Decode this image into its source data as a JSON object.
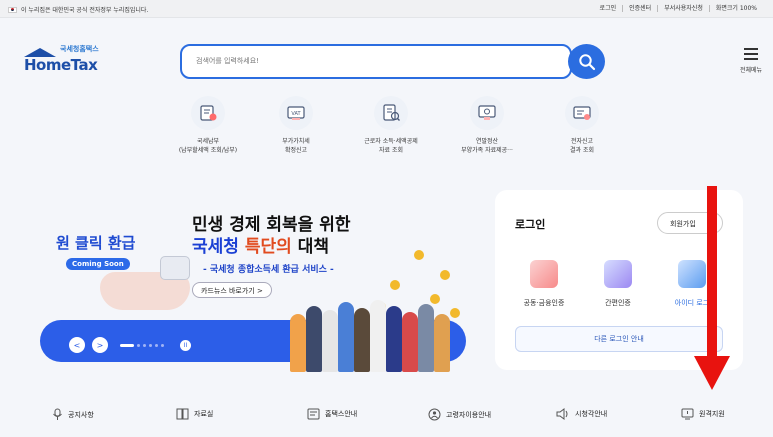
{
  "topbar": {
    "gov_notice": "이 누리집은 대한민국 공식 전자정부 누리집입니다.",
    "links": [
      "로그인",
      "인증센터",
      "부서사용자신청",
      "화면크기 100%"
    ]
  },
  "logo": {
    "small": "국세청홈택스",
    "big": "HomeTax"
  },
  "search": {
    "placeholder": "검색어를 입력하세요!"
  },
  "menu": {
    "label": "전체메뉴"
  },
  "quick_menu": [
    {
      "line1": "국세납부",
      "line2": "(납부할세액 조회/납부)",
      "icon": "tax-payment-icon"
    },
    {
      "line1": "부가가치세",
      "line2": "확정신고",
      "icon": "vat-icon"
    },
    {
      "line1": "근로자 소득·세액공제",
      "line2": "자료 조회",
      "icon": "income-deduction-icon"
    },
    {
      "line1": "연말정산",
      "line2": "부양가족 자료제공···",
      "icon": "year-end-settlement-icon"
    },
    {
      "line1": "전자신고",
      "line2": "결과 조회",
      "icon": "e-filing-result-icon"
    }
  ],
  "banner": {
    "one_click": "원 클릭 환급",
    "coming_soon": "Coming Soon",
    "headline1": "민생 경제 회복을 위한",
    "headline2_a": "국세청",
    "headline2_b": "특단의",
    "headline2_c": "대책",
    "subline": "- 국세청 종합소득세 환급 서비스 -",
    "cardnews": "카드뉴스 바로가기  >",
    "prev": "<",
    "next": ">",
    "pause": "II"
  },
  "login": {
    "title": "로그인",
    "join": "회원가입",
    "options": [
      "공동·금융인증",
      "간편인증",
      "아이디 로그"
    ],
    "other": "다른 로그인 안내"
  },
  "bottom_links": [
    {
      "label": "공지사항",
      "icon": "microphone-icon"
    },
    {
      "label": "자료실",
      "icon": "book-icon"
    },
    {
      "label": "홈택스안내",
      "icon": "guide-icon"
    },
    {
      "label": "고령자이용안내",
      "icon": "senior-guide-icon"
    },
    {
      "label": "시청각안내",
      "icon": "speaker-icon"
    },
    {
      "label": "원격지원",
      "icon": "remote-support-icon"
    }
  ],
  "colors": {
    "primary": "#2b6de0",
    "banner_blue": "#2c5ee8",
    "annotation_red": "#e8130f"
  }
}
